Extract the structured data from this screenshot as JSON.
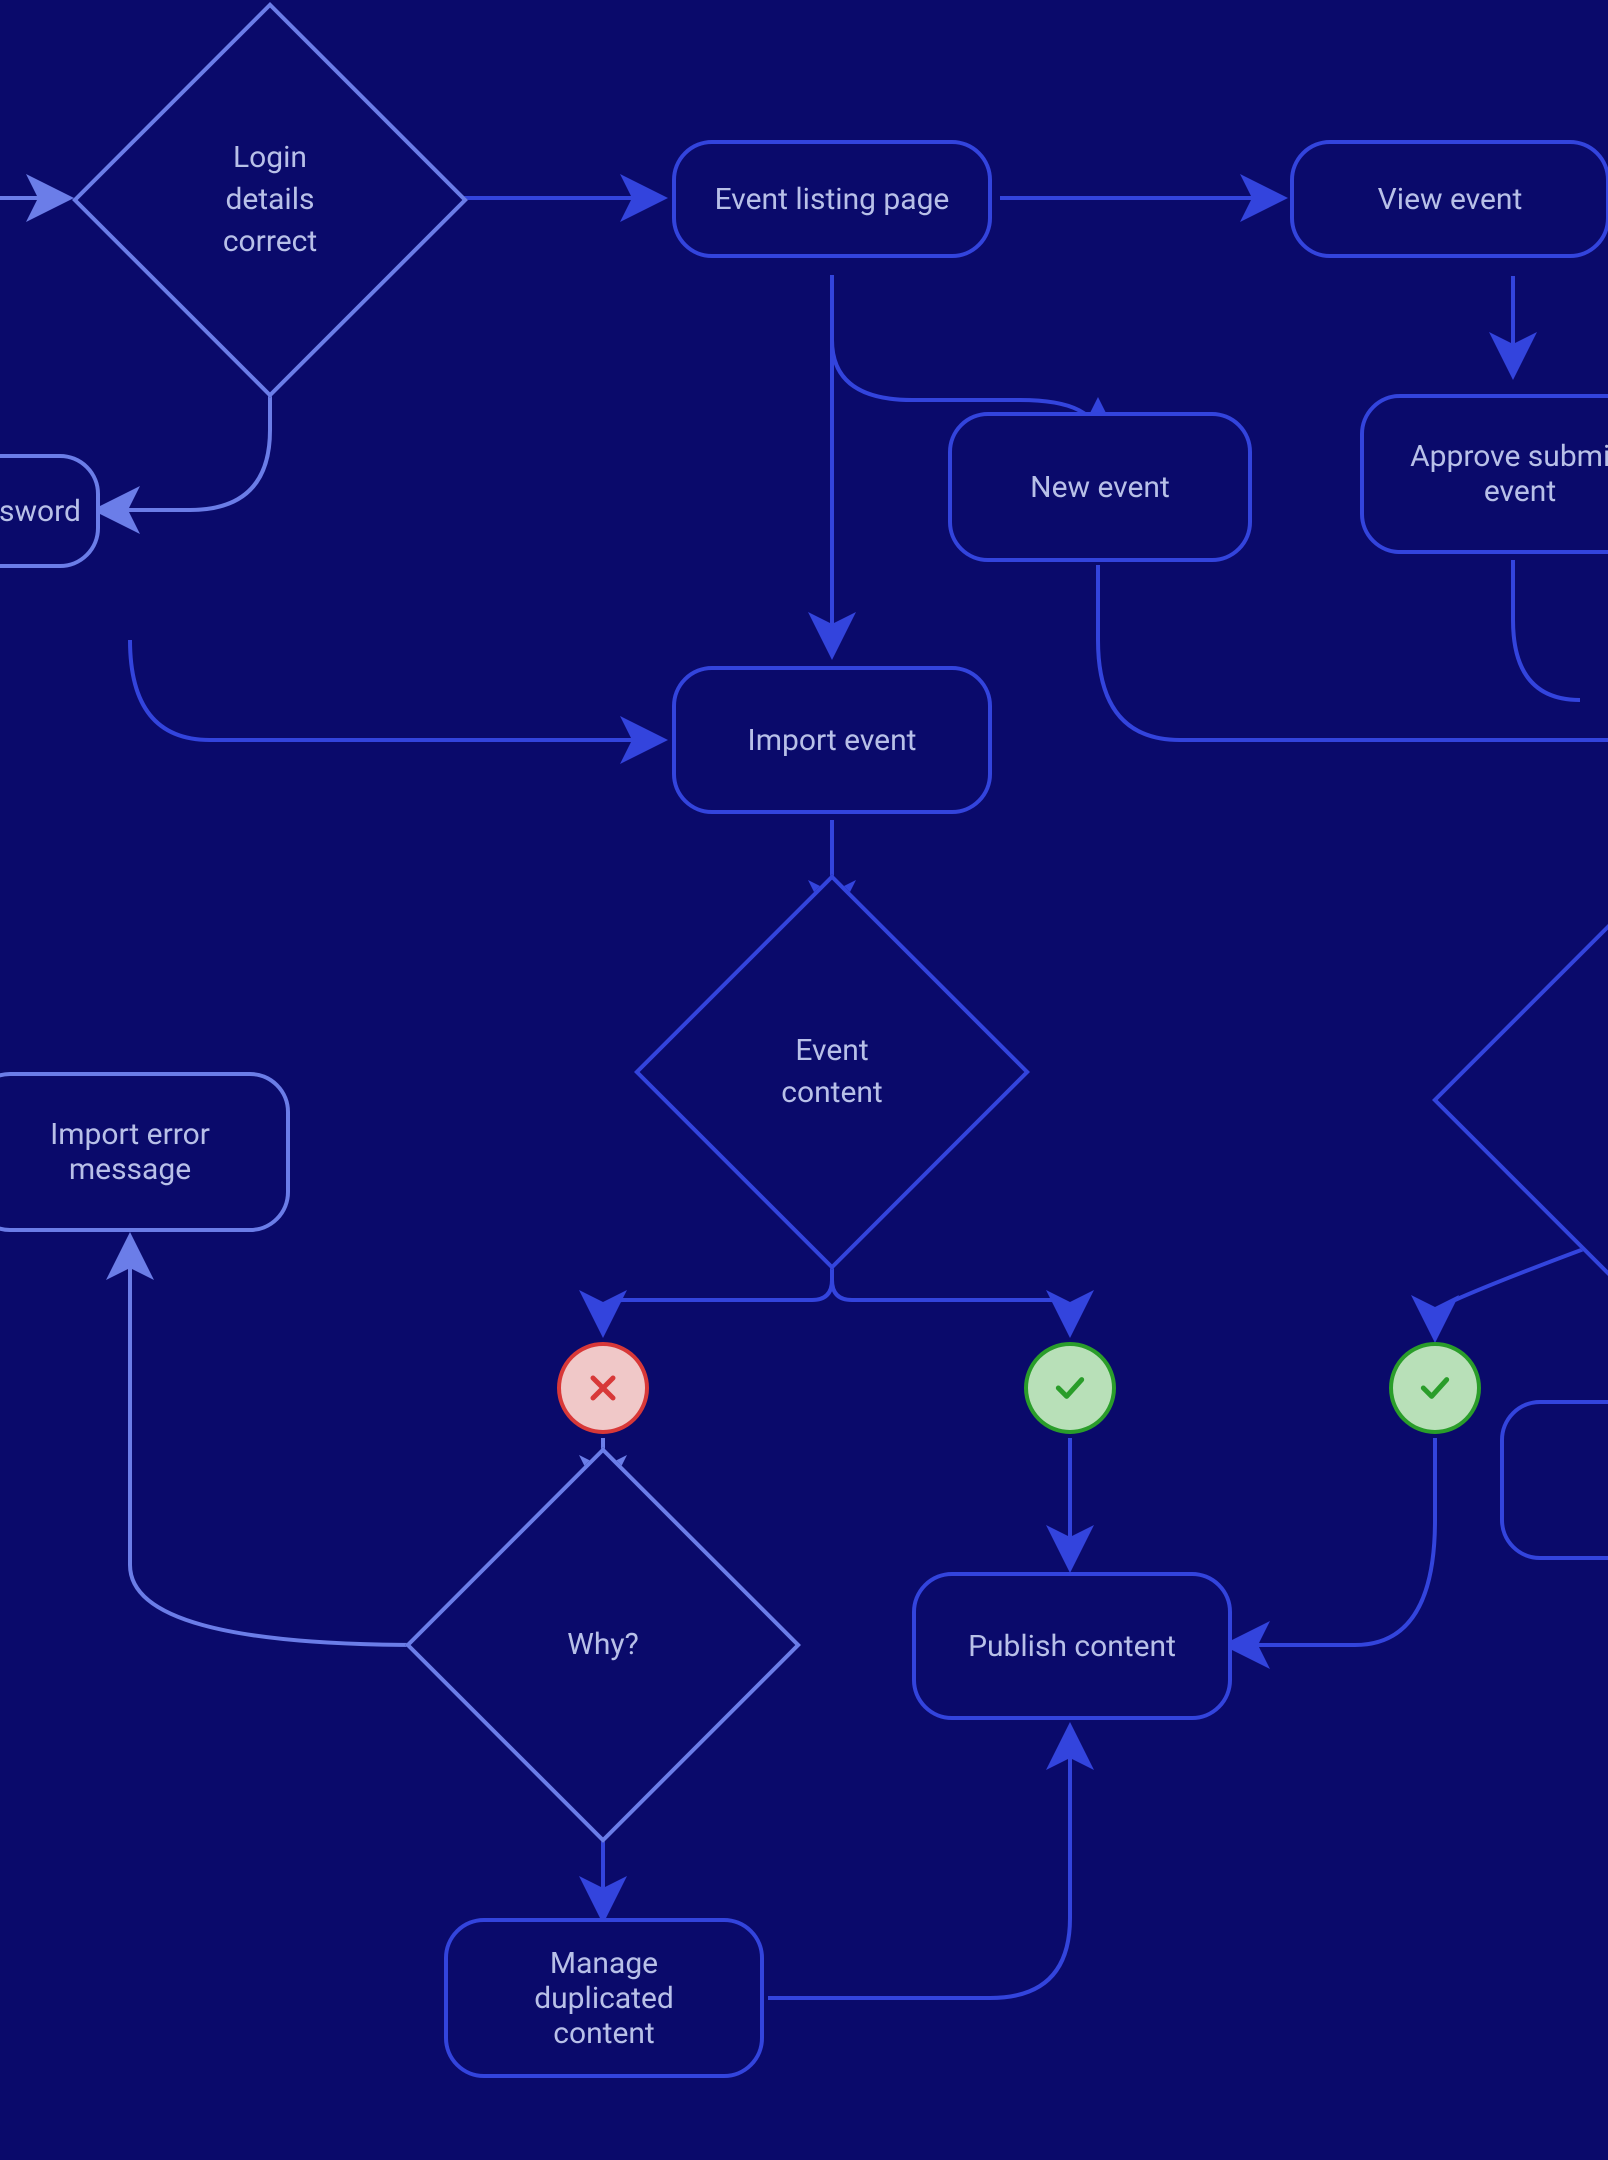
{
  "flowchart": {
    "nodes": {
      "login_details": "Login\ndetails\ncorrect",
      "event_listing": "Event listing page",
      "view_event": "View event",
      "password": "sword",
      "new_event": "New event",
      "approve_submitted": "Approve submitt\nevent",
      "import_event": "Import event",
      "event_content": "Event\ncontent",
      "import_error": "Import error\nmessage",
      "why": "Why?",
      "publish_content": "Publish content",
      "manage_duplicated": "Manage duplicated\ncontent"
    },
    "colors": {
      "background": "#0a0a6b",
      "border_primary": "#3344dd",
      "border_light": "#6b7de8",
      "text": "#b8c0e8",
      "success_bg": "#b8e0b8",
      "success_border": "#2a9d2a",
      "error_bg": "#f0c8c8",
      "error_border": "#d83838"
    }
  }
}
